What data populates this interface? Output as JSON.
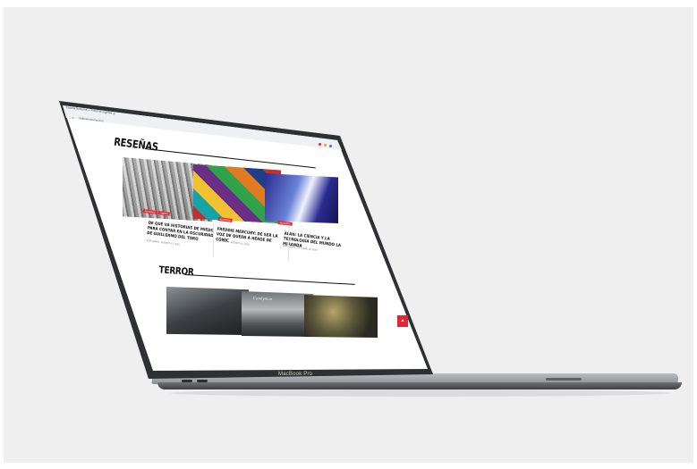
{
  "browser": {
    "tab_title": "Cadena Nocturna — Portal de reseñas",
    "tab_close": "×",
    "tab_new": "+",
    "address": "cadenanocturna.com",
    "nav": "←  →  ⟳"
  },
  "sections": {
    "resenas": {
      "heading": "RESEÑAS"
    },
    "terror": {
      "heading": "TERROR"
    }
  },
  "cards": [
    {
      "badges": [
        "RESEÑAS",
        "LIBROS"
      ],
      "title": "DE QUÉ VA HISTORIAS DE MIEDO PARA CONTAR EN LA OSCURIDAD DE GUILLERMO DEL TORO",
      "meta": "POR ADMIN · AGOSTO 17, 2020"
    },
    {
      "badges": [
        "RESEÑAS"
      ],
      "title": "FREDDIE MERCURY: DE SER LA VOZ DE QUEEN A HÉROE DE CÓMIC",
      "meta": "POR ADMIN · AGOSTO 15, 2020"
    },
    {
      "badges": [
        "RESEÑAS"
      ],
      "title": "ALAN: LA CIENCIA Y LA TECNOLOGÍA DEL MUNDO LA MIRANDA",
      "meta": "POR ADMIN · OCTUBRE 05, 2020"
    }
  ],
  "terror": {
    "caption": "Candyman"
  },
  "fab_icon": "▲",
  "device_label": "MacBook Pro",
  "colors": {
    "accent": "#e3262f",
    "backdrop": "#efefef",
    "bezel": "#2f3033"
  }
}
